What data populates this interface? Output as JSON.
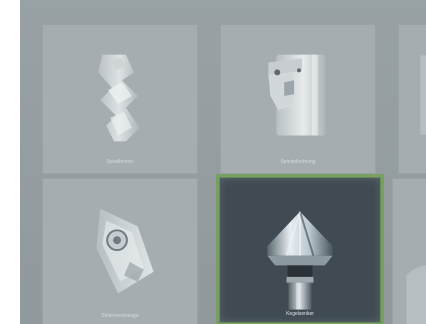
{
  "gallery": {
    "tiles": [
      {
        "label": "Spiralbohrer",
        "icon": "twist-drill-icon"
      },
      {
        "label": "Spindelbohrung",
        "icon": "indexable-drill-icon"
      },
      {
        "label": "",
        "icon": "partial-tool-icon"
      },
      {
        "label": "Sinterwerkzeuge",
        "icon": "indexable-insert-icon"
      },
      {
        "label": "Kegelsenker",
        "icon": "countersink-icon",
        "selected": true
      },
      {
        "label": "",
        "icon": "partial-tool-icon"
      }
    ]
  },
  "colors": {
    "background": "#959ea1",
    "tile": "#a5adb0",
    "selected_tile": "#3f4a52",
    "selected_border": "#76a163"
  }
}
